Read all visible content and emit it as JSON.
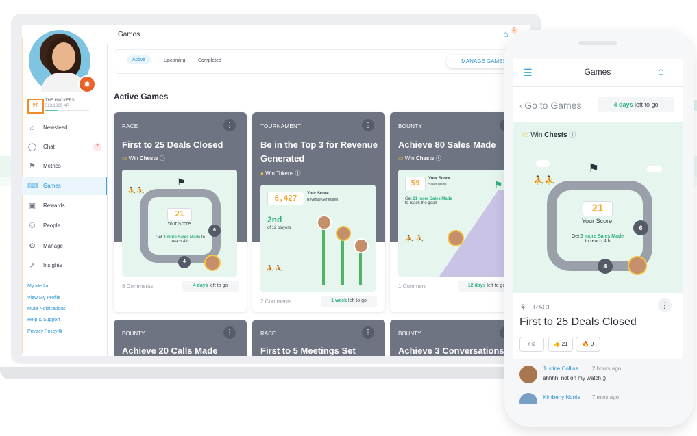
{
  "app": {
    "page_title": "Games",
    "notification_count": "3"
  },
  "profile": {
    "level": "26",
    "team": "THE HACKERS",
    "xp": "523/1889 XP",
    "xp_progress": 0.28
  },
  "sidebar": {
    "items": [
      {
        "label": "Newsfeed",
        "icon": "home-icon"
      },
      {
        "label": "Chat",
        "icon": "chat-icon",
        "badge": "7"
      },
      {
        "label": "Metrics",
        "icon": "chart-icon"
      },
      {
        "label": "Games",
        "icon": "gamepad-icon",
        "active": true
      },
      {
        "label": "Rewards",
        "icon": "gift-icon"
      },
      {
        "label": "People",
        "icon": "people-icon"
      },
      {
        "label": "Manage",
        "icon": "gear-icon"
      },
      {
        "label": "Insights",
        "icon": "trend-icon"
      }
    ],
    "links": [
      "My Media",
      "View My Profile",
      "Mute Notifications",
      "Help & Support",
      "Privacy Policy"
    ]
  },
  "tabs": {
    "items": [
      "Active",
      "Upcoming",
      "Completed"
    ],
    "manage_label": "MANAGE GAMES"
  },
  "section_title": "Active Games",
  "cards": [
    {
      "type": "RACE",
      "title": "First to 25 Deals Closed",
      "prize_prefix": "Win",
      "prize": "Chests",
      "comments": "8 Comments",
      "days_bold": "4 days",
      "days_rest": " left to go",
      "art": {
        "score": "21",
        "score_label": "Your Score",
        "hint_pre": "Get ",
        "hint_bold": "3 more Sales Made",
        "hint_post": " to reach 4th",
        "rank_a": "6",
        "rank_b": "4"
      }
    },
    {
      "type": "TOURNAMENT",
      "title": "Be in the Top 3 for Revenue Generated",
      "prize_prefix": "Win",
      "prize": "Tokens",
      "comments": "2 Comments",
      "days_bold": "1 week",
      "days_rest": " left to go",
      "art": {
        "score": "6,427",
        "score_label": "Your Score",
        "score_sub": "Revenue Generated",
        "place": "2nd",
        "place_sub": "of 12 players"
      }
    },
    {
      "type": "BOUNTY",
      "title": "Achieve 80 Sales Made",
      "prize_prefix": "Win",
      "prize": "Chests",
      "comments": "1 Comment",
      "days_bold": "12 days",
      "days_rest": " left to go",
      "art": {
        "score": "59",
        "score_label": "Your Score",
        "score_sub": "Sales Made",
        "hint_pre": "Get ",
        "hint_bold": "21 more Sales Made",
        "hint_post": " to reach the goal!"
      }
    }
  ],
  "cards_row2": [
    {
      "type": "BOUNTY",
      "title": "Achieve 20 Calls Made"
    },
    {
      "type": "RACE",
      "title": "First to 5 Meetings Set"
    },
    {
      "type": "BOUNTY",
      "title": "Achieve 3 Conversations"
    }
  ],
  "phone": {
    "title": "Games",
    "back": "Go to Games",
    "days_bold": "4 days",
    "days_rest": " left to go",
    "prize_prefix": "Win",
    "prize": "Chests",
    "art": {
      "score": "21",
      "score_label": "Your Score",
      "hint_pre": "Get ",
      "hint_bold": "3 more Sales Made",
      "hint_post": " to reach 4th",
      "rank_a": "6",
      "rank_b": "4"
    },
    "type": "RACE",
    "game_title": "First to 25 Deals Closed",
    "reactions": [
      {
        "emoji": "+☺",
        "count": ""
      },
      {
        "emoji": "👍",
        "count": "21"
      },
      {
        "emoji": "🔥",
        "count": "9"
      }
    ],
    "comments": [
      {
        "name": "Justine Collins",
        "time": "2 hours ago",
        "text": "ahhhh, not on my watch ;)"
      },
      {
        "name": "Kimberly Norris",
        "time": "7 mins ago",
        "text": ""
      }
    ]
  },
  "colors": {
    "accent": "#3ba6de",
    "green": "#2fae82",
    "card_header": "#6f7483",
    "orange": "#f28c28"
  }
}
